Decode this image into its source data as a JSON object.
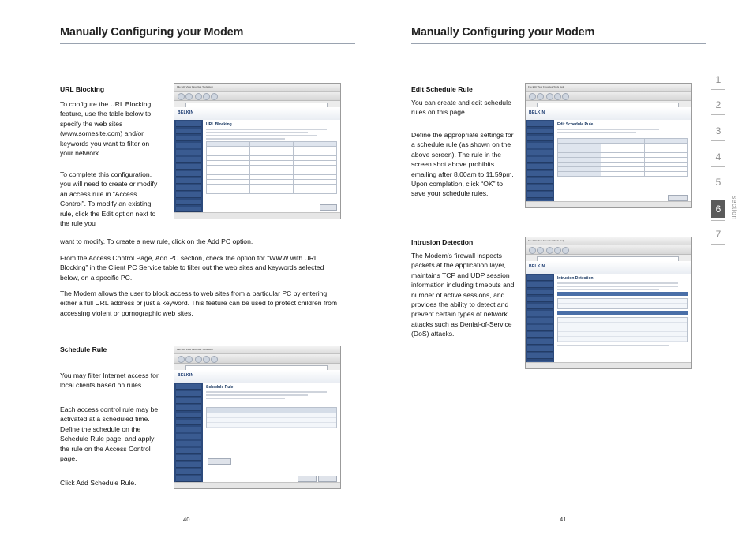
{
  "document": {
    "left_page": {
      "header": "Manually Configuring your Modem",
      "folio": "40",
      "sections": [
        {
          "heading": "URL Blocking",
          "paragraphs": [
            "To configure the URL Blocking feature, use the table below to specify the web sites (www.somesite.com) and/or keywords you want to filter on your network.",
            "To complete this configuration, you will need to create or modify an access rule in “Access Control”. To modify an existing rule, click the Edit option next to the rule you",
            "want to modify. To create a new rule, click on the Add PC option.",
            "From the Access Control Page, Add PC section, check the option for “WWW with URL Blocking” in the Client PC Service table to filter out the web sites and keywords selected below, on a specific PC.",
            "The Modem allows the user to block access to web sites from a particular PC by entering either a full URL address or just a keyword. This feature can be used to protect children from accessing violent or pornographic web sites."
          ]
        },
        {
          "heading": "Schedule Rule",
          "paragraphs": [
            "You may filter Internet access for local clients based on rules.",
            "Each access control rule may be activated at a scheduled time. Define the schedule on the Schedule Rule page, and apply the rule on the Access Control page.",
            "Click Add Schedule Rule."
          ]
        }
      ],
      "screenshots": [
        {
          "name": "url-blocking-screen",
          "brand": "BELKIN",
          "page_title": "URL Blocking"
        },
        {
          "name": "schedule-rule-screen",
          "brand": "BELKIN",
          "page_title": "Schedule Rule"
        }
      ]
    },
    "right_page": {
      "header": "Manually Configuring your Modem",
      "folio": "41",
      "sections": [
        {
          "heading": "Edit Schedule Rule",
          "paragraphs": [
            "You can create and edit schedule rules on this page.",
            "Define the appropriate settings for a schedule rule (as shown on the above screen). The rule in the screen shot above prohibits emailing after 8.00am to 11.59pm. Upon completion, click “OK” to save your schedule rules."
          ]
        },
        {
          "heading": "Intrusion Detection",
          "paragraphs": [
            "The Modem’s firewall inspects packets at the application layer, maintains TCP and UDP session information including timeouts and number of active sessions, and provides the ability to detect and prevent certain types of network attacks such as Denial-of-Service (DoS) attacks."
          ]
        }
      ],
      "screenshots": [
        {
          "name": "edit-schedule-rule-screen",
          "brand": "BELKIN",
          "page_title": "Edit Schedule Rule"
        },
        {
          "name": "intrusion-detection-screen",
          "brand": "BELKIN",
          "page_title": "Intrusion Detection"
        }
      ]
    },
    "section_rail": {
      "numbers": [
        "1",
        "2",
        "3",
        "4",
        "5",
        "6",
        "7"
      ],
      "current": "6",
      "label": "section"
    }
  }
}
